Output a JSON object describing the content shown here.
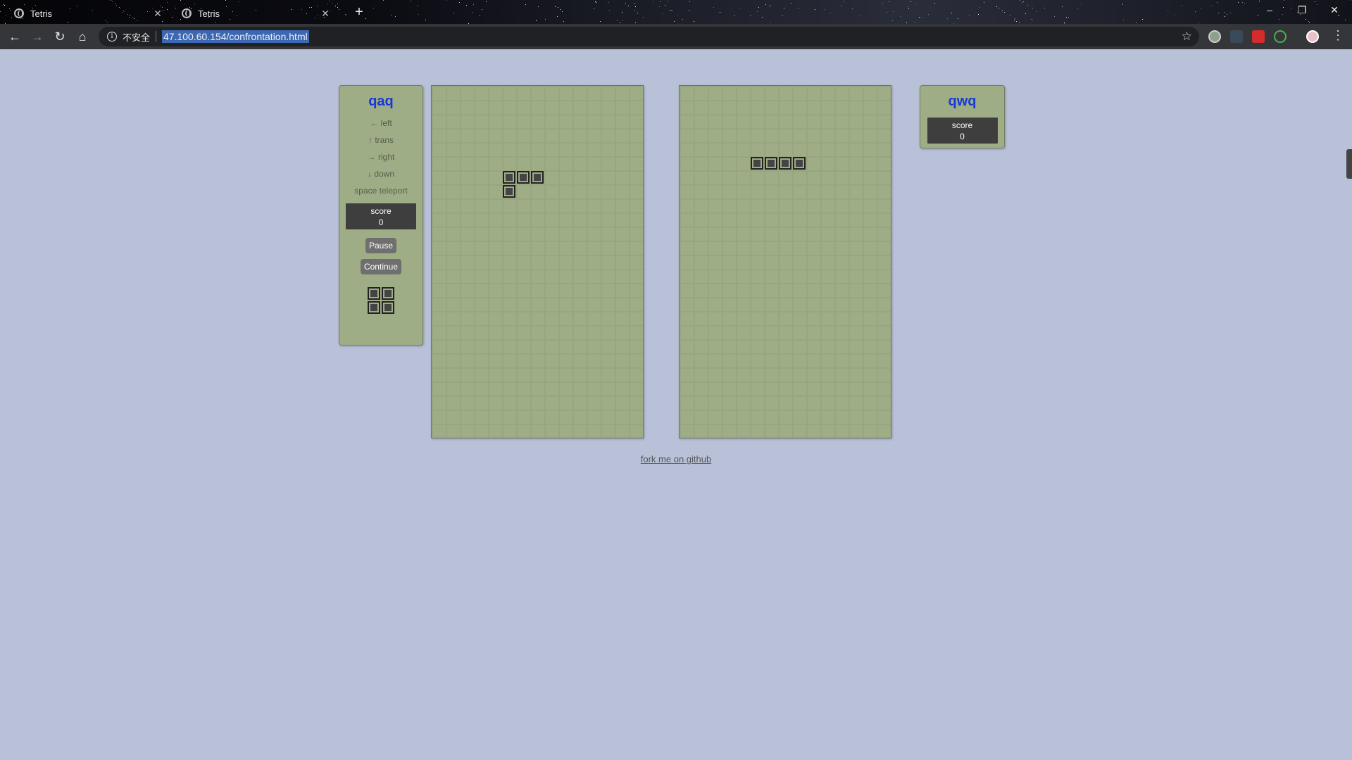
{
  "browser": {
    "tabs": [
      {
        "title": "Tetris",
        "active": false
      },
      {
        "title": "Tetris",
        "active": true
      }
    ],
    "address": {
      "security_label": "不安全",
      "url": "47.100.60.154/confrontation.html"
    },
    "icons": {
      "back": "back-arrow-icon",
      "forward": "forward-arrow-icon",
      "reload": "reload-icon",
      "home": "home-icon",
      "bookmark": "star-icon",
      "menu": "menu-dots-icon"
    }
  },
  "game": {
    "colors": {
      "page_background": "#b8c1d8",
      "board": "#9ead86",
      "player_name": "#1639d8",
      "score_box": "#3e3e3e",
      "block": "#444444"
    },
    "player1": {
      "name": "qaq",
      "controls": [
        {
          "key": "←",
          "action": "left"
        },
        {
          "key": "↑",
          "action": "trans"
        },
        {
          "key": "→",
          "action": "right"
        },
        {
          "key": "↓",
          "action": "down"
        },
        {
          "key": "space",
          "action": "teleport"
        }
      ],
      "score_label": "score",
      "score": "0",
      "pause_label": "Pause",
      "continue_label": "Continue",
      "next_piece": "O"
    },
    "player2": {
      "name": "qwq",
      "score_label": "score",
      "score": "0"
    },
    "board1_piece": {
      "shape": "L",
      "cells_col_row": [
        [
          5,
          6
        ],
        [
          6,
          6
        ],
        [
          7,
          6
        ],
        [
          5,
          7
        ]
      ]
    },
    "board2_piece": {
      "shape": "I",
      "cells_col_row": [
        [
          5,
          5
        ],
        [
          6,
          5
        ],
        [
          7,
          5
        ],
        [
          8,
          5
        ]
      ]
    },
    "board_grid": {
      "columns": 15,
      "rows": 25
    },
    "footer_link": "fork me on github"
  }
}
